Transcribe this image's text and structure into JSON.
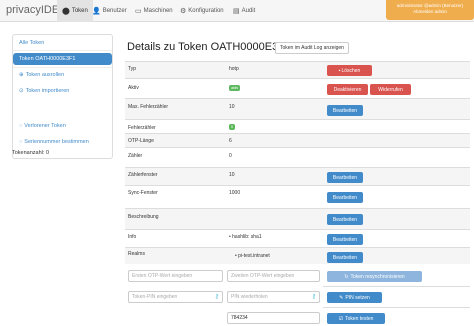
{
  "nav": {
    "brand": "privacyIDEA",
    "items": [
      {
        "label": "Token",
        "icon": "tag-icon"
      },
      {
        "label": "Benutzer",
        "icon": "user-icon"
      },
      {
        "label": "Maschinen",
        "icon": "monitor-icon"
      },
      {
        "label": "Konfiguration",
        "icon": "gear-icon"
      },
      {
        "label": "Audit",
        "icon": "audit-icon"
      }
    ],
    "user_line1": "administrator @admin (Benutzer)",
    "user_line2": "Abmelden   admin"
  },
  "sidebar": {
    "items": [
      {
        "label": "Alle Token"
      },
      {
        "label": "Token OATH0000E3F1"
      },
      {
        "label": "Token ausrollen",
        "icon": "plus-icon"
      },
      {
        "label": "Token importieren",
        "icon": "import-icon"
      },
      {
        "label": "Verlorener Token",
        "icon": "lost-icon"
      },
      {
        "label": "Seriennummer bestimmen",
        "icon": "serial-icon"
      }
    ],
    "token_count": "Tokenanzahl: 0"
  },
  "main": {
    "title": "Details zu Token OATH0000E3F1",
    "audit_button": "Token im Audit Log anzeigen",
    "rows": {
      "typ": {
        "label": "Typ",
        "value": "hotp"
      },
      "aktiv": {
        "label": "Aktiv",
        "badge": "aktiv"
      },
      "max_fail": {
        "label": "Max. Fehlerzähler",
        "value": "10"
      },
      "fail": {
        "label": "Fehlerzähler",
        "badge": "0"
      },
      "otp_len": {
        "label": "OTP-Länge",
        "value": "6"
      },
      "zaehler": {
        "label": "Zähler",
        "value": "0"
      },
      "zaehlerfenster": {
        "label": "Zählerfenster",
        "value": "10"
      },
      "sync": {
        "label": "Sync-Fenster",
        "value": "1000"
      },
      "beschreibung": {
        "label": "Beschreibung",
        "value": ""
      },
      "info": {
        "label": "Info",
        "value": "hashlib: sha1"
      },
      "realms": {
        "label": "Realms",
        "value": "pi-test.intranet"
      }
    },
    "buttons": {
      "delete": "Löschen",
      "deactivate": "Deaktivieren",
      "revoke": "Widerrufen",
      "edit": "Bearbeiten",
      "resync": "Token   resynchronisieren",
      "set_pin": "PIN   setzen",
      "test": "Token   testen"
    },
    "inputs": {
      "otp1_placeholder": "Ersten OTP-Wert eingeben",
      "otp2_placeholder": "Zweiten OTP-Wert eingeben",
      "pin_placeholder": "Token-PIN eingeben",
      "pin_repeat_placeholder": "PIN wiederholen",
      "test_value": "784234"
    }
  }
}
